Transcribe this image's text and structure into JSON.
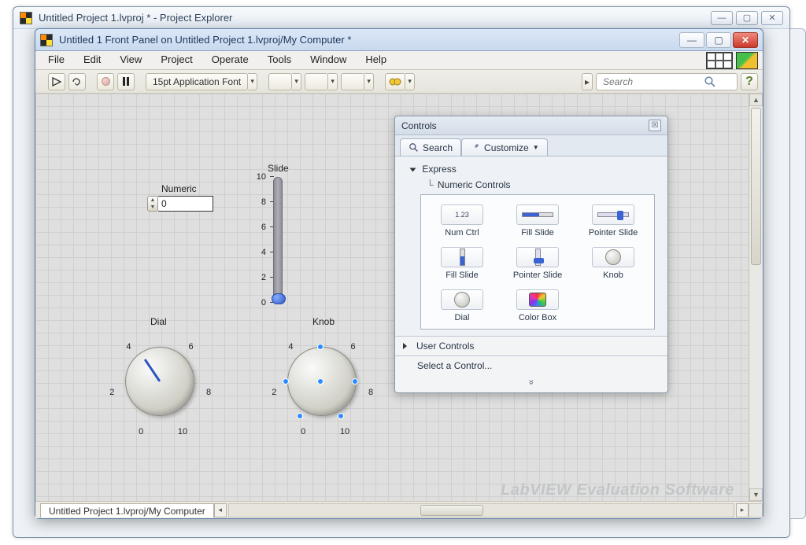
{
  "explorer": {
    "title": "Untitled Project 1.lvproj * - Project Explorer"
  },
  "frontpanel": {
    "title": "Untitled 1 Front Panel on Untitled Project 1.lvproj/My Computer *",
    "menus": [
      "File",
      "Edit",
      "View",
      "Project",
      "Operate",
      "Tools",
      "Window",
      "Help"
    ],
    "font": "15pt Application Font",
    "search_placeholder": "Search"
  },
  "controls": {
    "numeric": {
      "label": "Numeric",
      "value": "0"
    },
    "slide": {
      "label": "Slide",
      "ticks": [
        "10",
        "8",
        "6",
        "4",
        "2",
        "0"
      ]
    },
    "dial": {
      "label": "Dial",
      "ticks": [
        "0",
        "2",
        "4",
        "6",
        "8",
        "10"
      ]
    },
    "knob": {
      "label": "Knob",
      "ticks": [
        "0",
        "2",
        "4",
        "6",
        "8",
        "10"
      ]
    }
  },
  "palette": {
    "title": "Controls",
    "search_label": "Search",
    "customize_label": "Customize",
    "express_label": "Express",
    "numeric_controls_label": "Numeric Controls",
    "items": [
      {
        "label": "Num Ctrl"
      },
      {
        "label": "Fill Slide"
      },
      {
        "label": "Pointer Slide"
      },
      {
        "label": "Fill Slide"
      },
      {
        "label": "Pointer Slide"
      },
      {
        "label": "Knob"
      },
      {
        "label": "Dial"
      },
      {
        "label": "Color Box"
      }
    ],
    "user_controls_label": "User Controls",
    "select_control_label": "Select a Control...",
    "more_glyph": "»"
  },
  "tabstrip": {
    "doc": "Untitled Project 1.lvproj/My Computer"
  },
  "watermark": "LabVIEW  Evaluation Software"
}
